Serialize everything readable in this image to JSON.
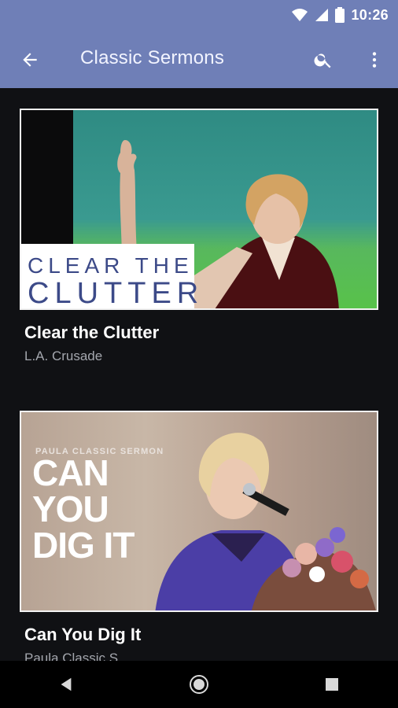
{
  "status_bar": {
    "time": "10:26"
  },
  "app_bar": {
    "title": "Classic Sermons"
  },
  "cards": [
    {
      "title": "Clear the Clutter",
      "subtitle": "L.A. Crusade",
      "thumbnail": {
        "line1": "CLEAR THE",
        "line2": "CLUTTER"
      }
    },
    {
      "title": "Can You Dig It",
      "subtitle": "Paula Classic S...",
      "thumbnail": {
        "label": "PAULA CLASSIC SERMON",
        "headline": "CAN YOU DIG IT"
      }
    }
  ],
  "colors": {
    "appbar": "#6f7fb7",
    "background": "#101114",
    "title_text": "#ffffff",
    "subtitle_text": "#a4a7ae"
  },
  "icons": [
    "back-arrow-icon",
    "search-icon",
    "more-vert-icon",
    "wifi-icon",
    "signal-icon",
    "battery-icon",
    "back-nav-icon",
    "home-nav-icon",
    "recents-nav-icon"
  ]
}
